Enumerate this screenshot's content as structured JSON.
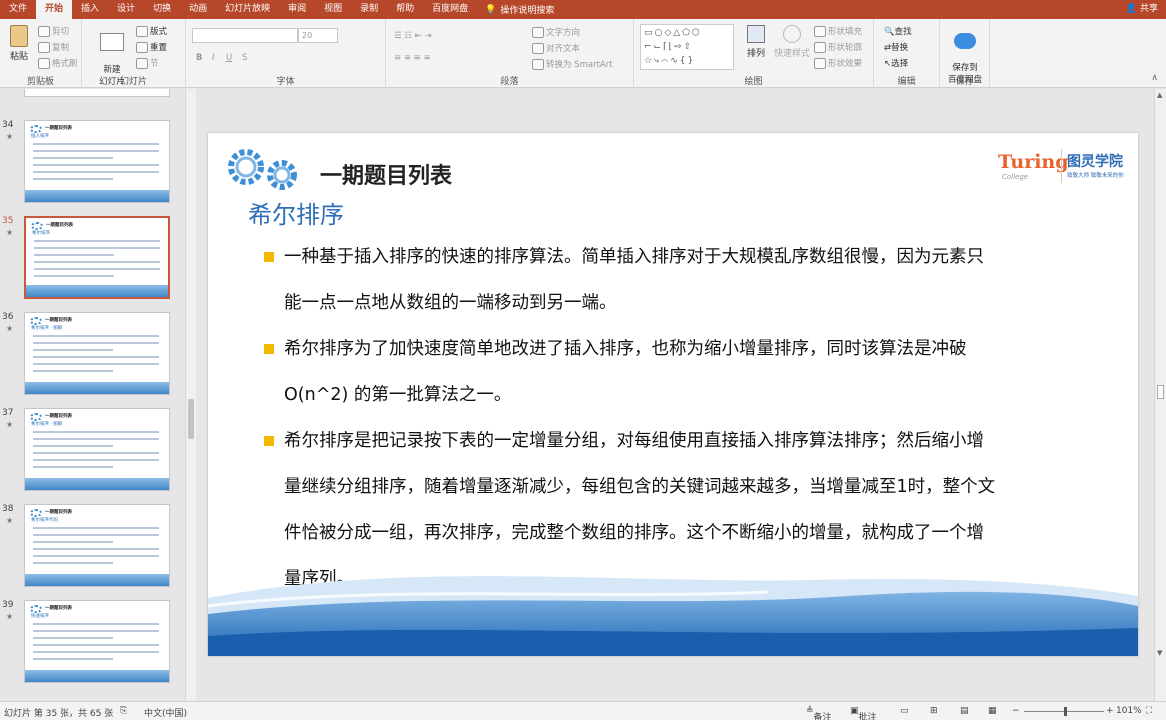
{
  "tabs": [
    "文件",
    "开始",
    "插入",
    "设计",
    "切换",
    "动画",
    "幻灯片放映",
    "审阅",
    "视图",
    "录制",
    "帮助",
    "百度网盘"
  ],
  "tell_me": "操作说明搜索",
  "share": "共享",
  "ribbon": {
    "clipboard": {
      "label": "剪贴板",
      "paste": "粘贴",
      "cut": "剪切",
      "copy": "复制",
      "format_painter": "格式刷"
    },
    "slides": {
      "label": "幻灯片",
      "new_slide": "新建\n幻灯片",
      "layout": "版式",
      "reset": "重置",
      "section": "节"
    },
    "font": {
      "label": "字体",
      "size": "20"
    },
    "paragraph": {
      "label": "段落",
      "text_direction": "文字方向",
      "align_text": "对齐文本",
      "convert_smartart": "转换为 SmartArt"
    },
    "drawing": {
      "label": "绘图",
      "arrange": "排列",
      "quick_styles": "快速样式",
      "shape_fill": "形状填充",
      "shape_outline": "形状轮廓",
      "shape_effects": "形状效果"
    },
    "editing": {
      "label": "编辑",
      "find": "查找",
      "replace": "替换",
      "select": "选择"
    },
    "save": {
      "label": "保存",
      "save_baidu": "保存到\n百度网盘"
    }
  },
  "thumbnails": [
    {
      "num": "34",
      "title": "一期题目列表",
      "sub": "插入排序"
    },
    {
      "num": "35",
      "title": "一期题目列表",
      "sub": "希尔排序",
      "selected": true
    },
    {
      "num": "36",
      "title": "一期题目列表",
      "sub": "希尔排序 · 图解"
    },
    {
      "num": "37",
      "title": "一期题目列表",
      "sub": "希尔排序 · 图解"
    },
    {
      "num": "38",
      "title": "一期题目列表",
      "sub": "希尔排序代码"
    },
    {
      "num": "39",
      "title": "一期题目列表",
      "sub": "快速排序"
    }
  ],
  "slide": {
    "title": "一期题目列表",
    "subtitle": "希尔排序",
    "logo_text": "Turing",
    "logo_sub": "College",
    "logo_cn": "图灵学院",
    "logo_slogan": "致敬大师 致敬未来的你",
    "bullets": [
      {
        "lines": [
          "一种基于插入排序的快速的排序算法。简单插入排序对于大规模乱序数组很慢，因为元素只",
          "能一点一点地从数组的一端移动到另一端。"
        ]
      },
      {
        "lines": [
          "希尔排序为了加快速度简单地改进了插入排序，也称为缩小增量排序，同时该算法是冲破",
          "O(n^2)  的第一批算法之一。"
        ]
      },
      {
        "lines": [
          "希尔排序是把记录按下表的一定增量分组，对每组使用直接插入排序算法排序；然后缩小增",
          "量继续分组排序，随着增量逐渐减少，每组包含的关键词越来越多，当增量减至1时，整个文",
          "件恰被分成一组，再次排序，完成整个数组的排序。这个不断缩小的增量，就构成了一个增",
          "量序列。"
        ]
      }
    ]
  },
  "status": {
    "slide_info": "幻灯片 第 35 张，共 65 张",
    "language": "中文(中国)",
    "notes": "备注",
    "comments": "批注",
    "zoom": "101%"
  },
  "colors": {
    "accent": "#b7472a",
    "title_blue": "#2f6fb6",
    "bullet": "#f5b800"
  }
}
